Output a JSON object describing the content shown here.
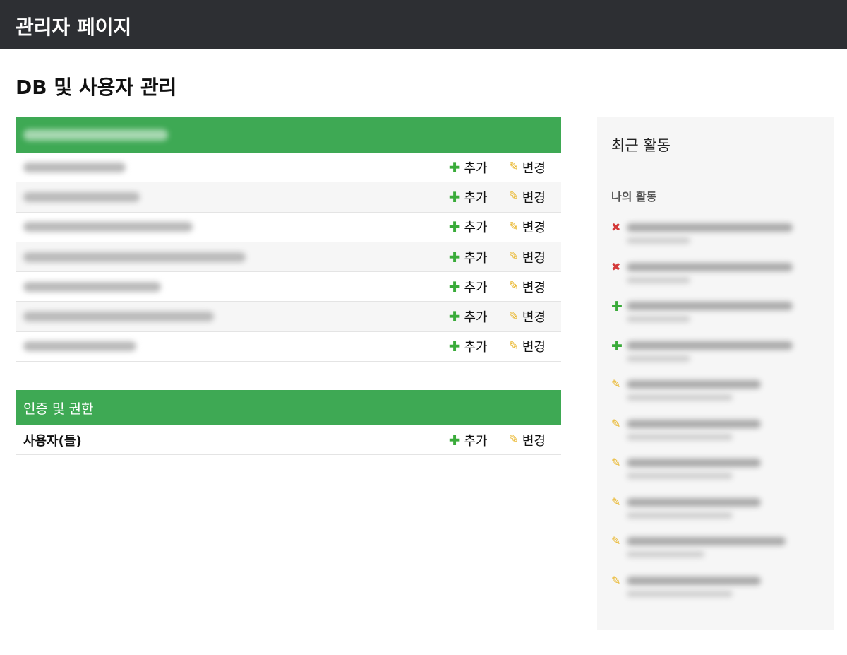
{
  "header": {
    "site_title": "관리자 페이지"
  },
  "page": {
    "title": "DB 및 사용자 관리"
  },
  "actions": {
    "add_label": "추가",
    "change_label": "변경"
  },
  "module_app": {
    "rows": [
      {},
      {},
      {},
      {},
      {},
      {},
      {}
    ]
  },
  "module_auth": {
    "title": "인증 및 권한",
    "rows": [
      {
        "name": "사용자(들)"
      }
    ]
  },
  "recent": {
    "title": "최근 활동",
    "my_actions_title": "나의 활동",
    "items": [
      {
        "icon": "delete-icon"
      },
      {
        "icon": "delete-icon"
      },
      {
        "icon": "add-icon"
      },
      {
        "icon": "add-icon"
      },
      {
        "icon": "pencil-icon"
      },
      {
        "icon": "pencil-icon"
      },
      {
        "icon": "pencil-icon"
      },
      {
        "icon": "pencil-icon"
      },
      {
        "icon": "pencil-icon"
      },
      {
        "icon": "pencil-icon"
      }
    ]
  },
  "colors": {
    "header_bg": "#2d2f33",
    "module_header": "#3ea954",
    "add": "#3aab3a",
    "change": "#e8b11c",
    "delete": "#d43a3a"
  }
}
